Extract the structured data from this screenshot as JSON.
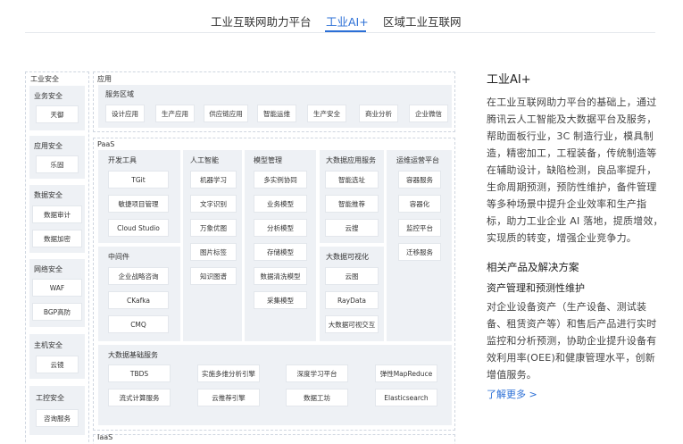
{
  "tabs": [
    "工业互联网助力平台",
    "工业AI+",
    "区域工业互联网"
  ],
  "left_groups": [
    {
      "title": "工业安全",
      "subtitle": "业务安全",
      "items": [
        "天御"
      ]
    },
    {
      "subtitle": "应用安全",
      "items": [
        "乐固"
      ]
    },
    {
      "subtitle": "数据安全",
      "items": [
        "数据审计",
        "数据加密"
      ]
    },
    {
      "subtitle": "网络安全",
      "items": [
        "WAF",
        "BGP高防"
      ]
    },
    {
      "subtitle": "主机安全",
      "items": [
        "云镜"
      ]
    },
    {
      "subtitle": "工控安全",
      "items": [
        "咨询服务"
      ]
    }
  ],
  "app": {
    "label": "应用",
    "region_label": "服务区域",
    "items": [
      "设计应用",
      "生产应用",
      "供应链应用",
      "智能运维",
      "生产安全",
      "商业分析",
      "企业微信"
    ]
  },
  "paas": {
    "label": "PaaS",
    "dev_tools": {
      "title": "开发工具",
      "items": [
        "TGit",
        "敏捷项目管理",
        "Cloud Studio"
      ]
    },
    "ai": {
      "title": "人工智能",
      "items": [
        "机器学习",
        "文字识别",
        "万象优图",
        "图片标签",
        "知识图谱"
      ]
    },
    "model_mgmt": {
      "title": "模型管理",
      "items": [
        "多实例协同",
        "业务模型",
        "分析模型",
        "存储模型",
        "数据清洗模型",
        "采集模型"
      ]
    },
    "bigdata_app": {
      "title": "大数据应用服务",
      "items": [
        "智能选址",
        "智能推荐",
        "云搜"
      ]
    },
    "ops": {
      "title": "运维运营平台",
      "items": [
        "容器服务",
        "容器化",
        "监控平台",
        "迁移服务"
      ]
    },
    "middleware": {
      "title": "中间件",
      "items": [
        "企业战略咨询",
        "CKafka",
        "CMQ"
      ]
    },
    "bigdata_vis": {
      "title": "大数据可视化",
      "items": [
        "云图",
        "RayData",
        "大数据可视交互"
      ]
    },
    "bigdata_base": {
      "title": "大数据基础服务",
      "items": [
        "TBDS",
        "实施多维分析引擎",
        "深度学习平台",
        "弹性MapReduce",
        "流式计算服务",
        "云推荐引擎",
        "数据工坊",
        "Elasticsearch"
      ]
    }
  },
  "iaas": {
    "label": "IaaS"
  },
  "right": {
    "title": "工业AI+",
    "body": "在工业互联网助力平台的基础上，通过腾讯云人工智能及大数据平台及服务，帮助面板行业，3C 制造行业，模具制造，精密加工，工程装备，传统制造等在辅助设计，缺陷检测，良品率提升，生命周期预测，预防性维护，备件管理等多种场景中提升企业效率和生产指标，助力工业企业 AI 落地，提质增效，实现质的转变，增强企业竞争力。",
    "related_title": "相关产品及解决方案",
    "solution_title": "资产管理和预测性维护",
    "solution_body": "对企业设备资产（生产设备、测试装备、租赁资产等）和售后产品进行实时监控和分析预测，协助企业提升设备有效利用率(OEE)和健康管理水平，创新增值服务。",
    "more_link": "了解更多 >"
  }
}
